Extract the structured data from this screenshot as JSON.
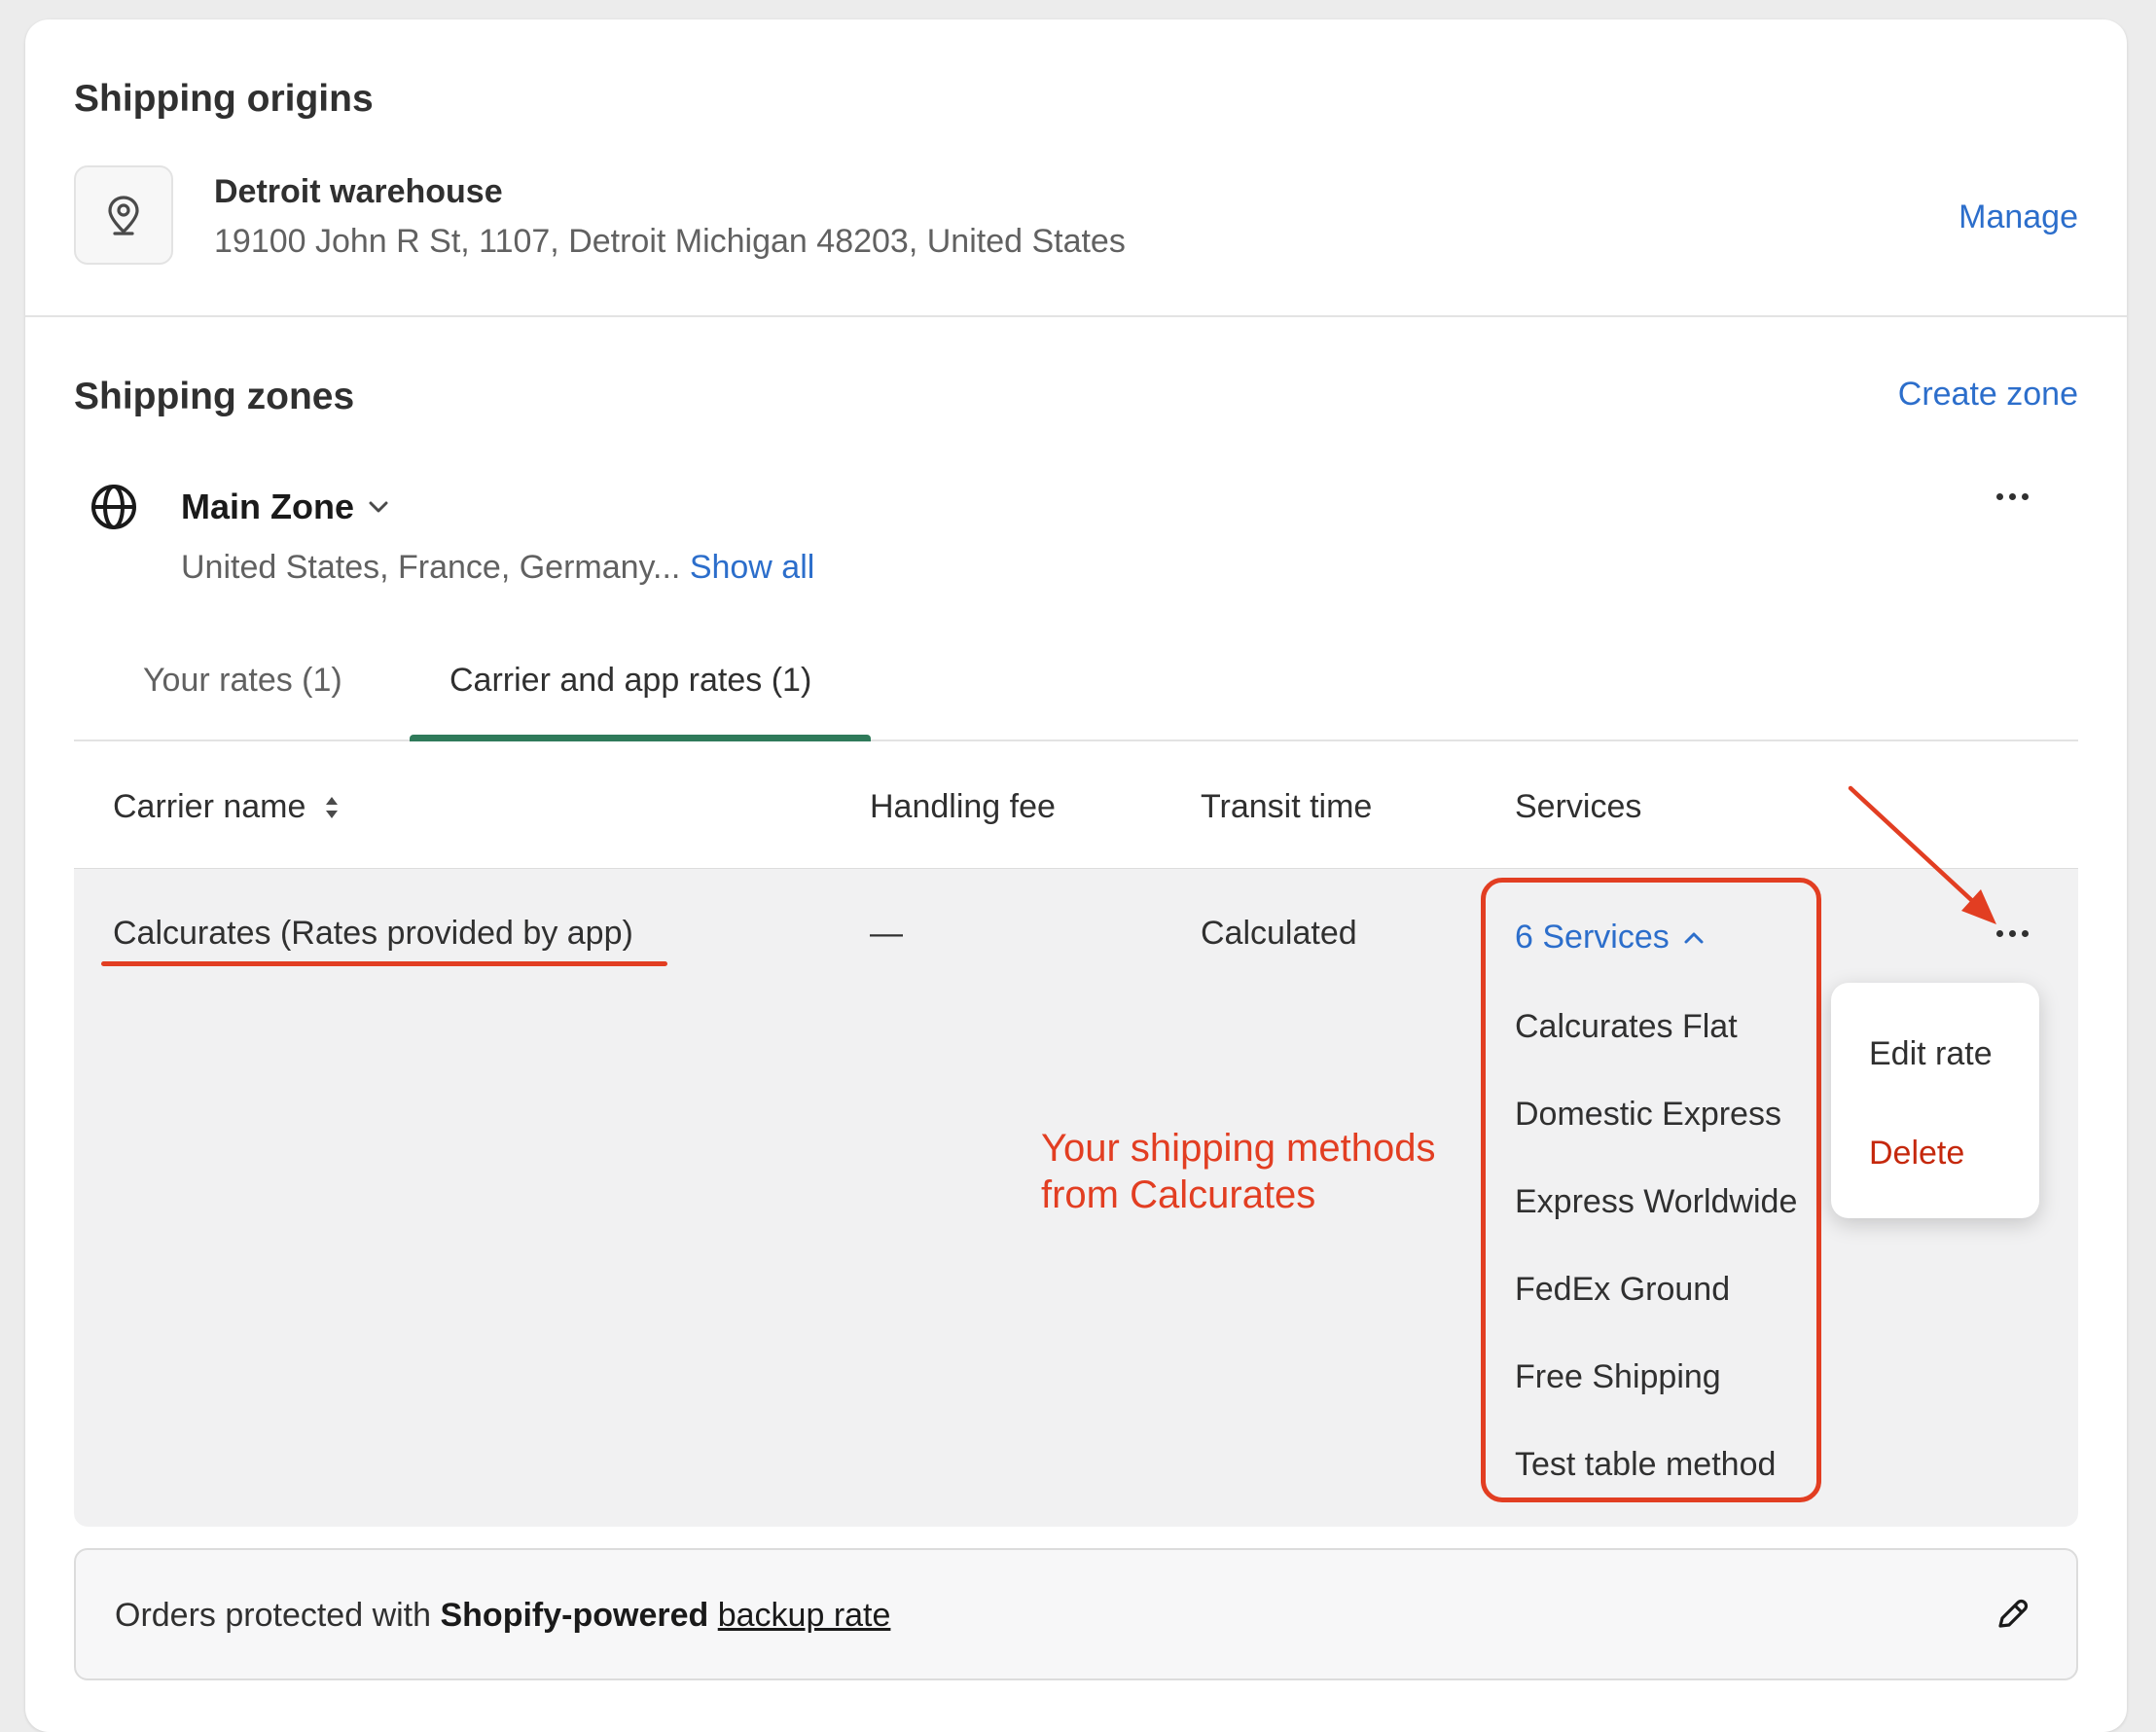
{
  "origins": {
    "title": "Shipping origins",
    "location_name": "Detroit warehouse",
    "address": "19100 John R St, 1107, Detroit Michigan 48203, United States",
    "manage_label": "Manage",
    "icon": "location-pin-icon"
  },
  "zones": {
    "title": "Shipping zones",
    "create_label": "Create zone",
    "zone": {
      "name": "Main Zone",
      "countries": "United States, France, Germany...",
      "show_all_label": "Show all",
      "icon": "globe-icon"
    }
  },
  "tabs": [
    {
      "label": "Your rates (1)",
      "active": false
    },
    {
      "label": "Carrier and app rates (1)",
      "active": true
    }
  ],
  "table": {
    "columns": [
      "Carrier name",
      "Handling fee",
      "Transit time",
      "Services"
    ],
    "row": {
      "carrier": "Calcurates (Rates provided by app)",
      "handling_fee": "—",
      "transit_time": "Calculated",
      "services_toggle": "6 Services",
      "services": [
        "Calcurates Flat",
        "Domestic Express",
        "Express Worldwide",
        "FedEx Ground",
        "Free Shipping",
        "Test table method"
      ]
    }
  },
  "menu": {
    "edit_label": "Edit rate",
    "delete_label": "Delete"
  },
  "annotation": {
    "line1": "Your shipping methods",
    "line2": "from Calcurates"
  },
  "backup": {
    "prefix": "Orders protected with ",
    "bold": "Shopify-powered",
    "link": "backup rate"
  },
  "colors": {
    "link": "#2c6ecb",
    "annotation_red": "#e23e22",
    "tab_active": "#2f7a5a",
    "delete_red": "#c5280c"
  }
}
